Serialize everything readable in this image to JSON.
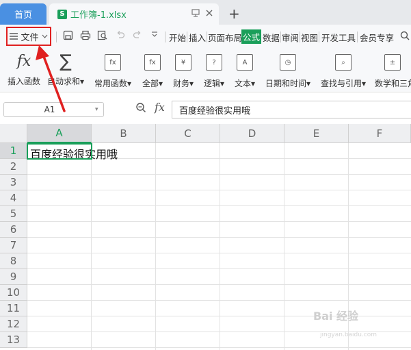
{
  "tabs": {
    "home": "首页",
    "doc_icon": "S",
    "doc_title": "工作簿-1.xlsx",
    "new_tab": "+"
  },
  "menu": {
    "file_label": "文件",
    "tabs": [
      "开始",
      "插入",
      "页面布局",
      "公式",
      "数据",
      "审阅",
      "视图",
      "开发工具",
      "会员专享"
    ],
    "active_tab": "公式"
  },
  "ribbon": {
    "buttons": [
      "插入函数",
      "自动求和",
      "常用函数",
      "全部",
      "财务",
      "逻辑",
      "文本",
      "日期和时间",
      "查找与引用",
      "数学和三角"
    ]
  },
  "formula_bar": {
    "name_box": "A1",
    "fx": "fx",
    "content": "百度经验很实用哦"
  },
  "grid": {
    "columns": [
      "A",
      "B",
      "C",
      "D",
      "E",
      "F"
    ],
    "rows": [
      "1",
      "2",
      "3",
      "4",
      "5",
      "6",
      "7",
      "8",
      "9",
      "10",
      "11",
      "12",
      "13"
    ],
    "selected_cell": "A1",
    "a1_value": "百度经验很实用哦"
  },
  "watermark": {
    "text": "Bai 经验",
    "sub": "jingyan.baidu.com"
  },
  "colors": {
    "accent": "#1a9f5a",
    "home_tab": "#4a90e2",
    "highlight": "#e02020"
  }
}
